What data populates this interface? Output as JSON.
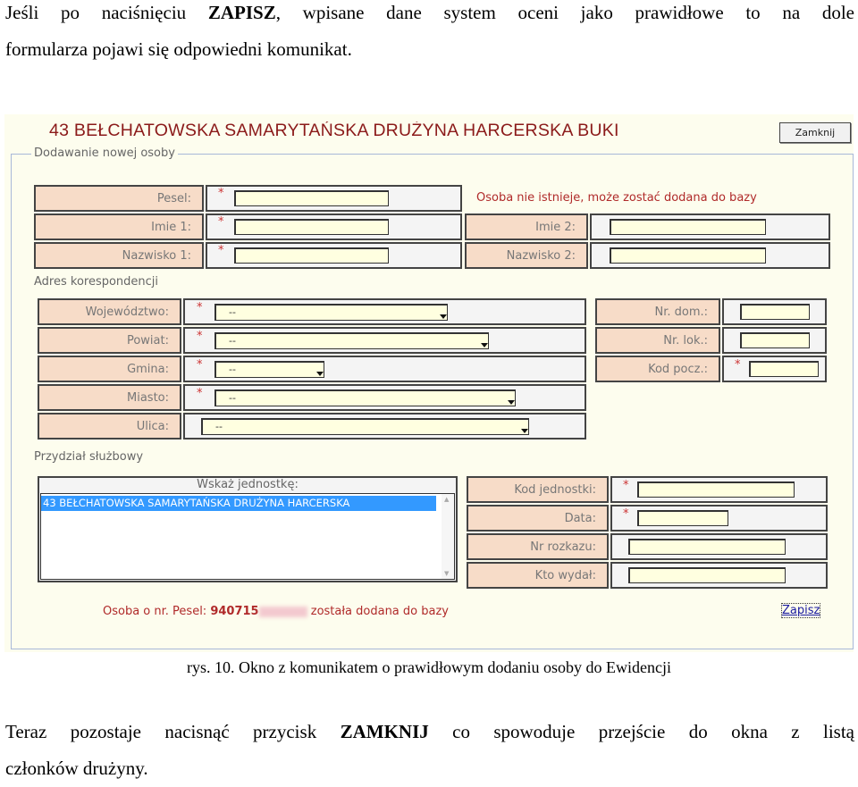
{
  "intro": {
    "before": "Jeśli po naciśnięciu ",
    "bold": "ZAPISZ",
    "line1_after": ", wpisane dane system oceni jako prawidłowe to na dole",
    "line2": "formularza pojawi się odpowiedni komunikat."
  },
  "screenshot": {
    "title": "43 BEŁCHATOWSKA SAMARYTAŃSKA DRUŻYNA HARCERSKA BUKI",
    "close_button": "Zamknij",
    "legend": "Dodawanie nowej osoby",
    "required_marker": "*",
    "person": {
      "pesel": "Pesel:",
      "imie1": "Imie 1:",
      "nazwisko1": "Nazwisko 1:",
      "imie2": "Imie 2:",
      "nazwisko2": "Nazwisko 2:",
      "status": "Osoba nie istnieje, może zostać dodana do bazy"
    },
    "address": {
      "section": "Adres korespondencji",
      "wojewodztwo": "Województwo:",
      "powiat": "Powiat:",
      "gmina": "Gmina:",
      "miasto": "Miasto:",
      "ulica": "Ulica:",
      "nr_dom": "Nr. dom.:",
      "nr_lok": "Nr. lok.:",
      "kod": "Kod pocz.:",
      "select_value": "--"
    },
    "assignment": {
      "section": "Przydział służbowy",
      "list_header": "Wskaż jednostkę:",
      "list_items": [
        "43 BEŁCHATOWSKA SAMARYTAŃSKA DRUŻYNA HARCERSKA"
      ],
      "kod_jednostki": "Kod jednostki:",
      "data": "Data:",
      "nr_rozkazu": "Nr rozkazu:",
      "kto_wydal": "Kto wydał:"
    },
    "message": {
      "prefix": "Osoba o nr. Pesel: ",
      "pesel": "940715",
      "suffix": " została dodana do bazy"
    },
    "save_link": "Zapisz"
  },
  "caption": "rys. 10. Okno z komunikatem o prawidłowym dodaniu osoby do Ewidencji",
  "outro": {
    "before": "Teraz pozostaje nacisnąć przycisk ",
    "bold": "ZAMKNIJ",
    "after": " co spowoduje przejście do okna z listą",
    "line2": "członków drużyny."
  }
}
